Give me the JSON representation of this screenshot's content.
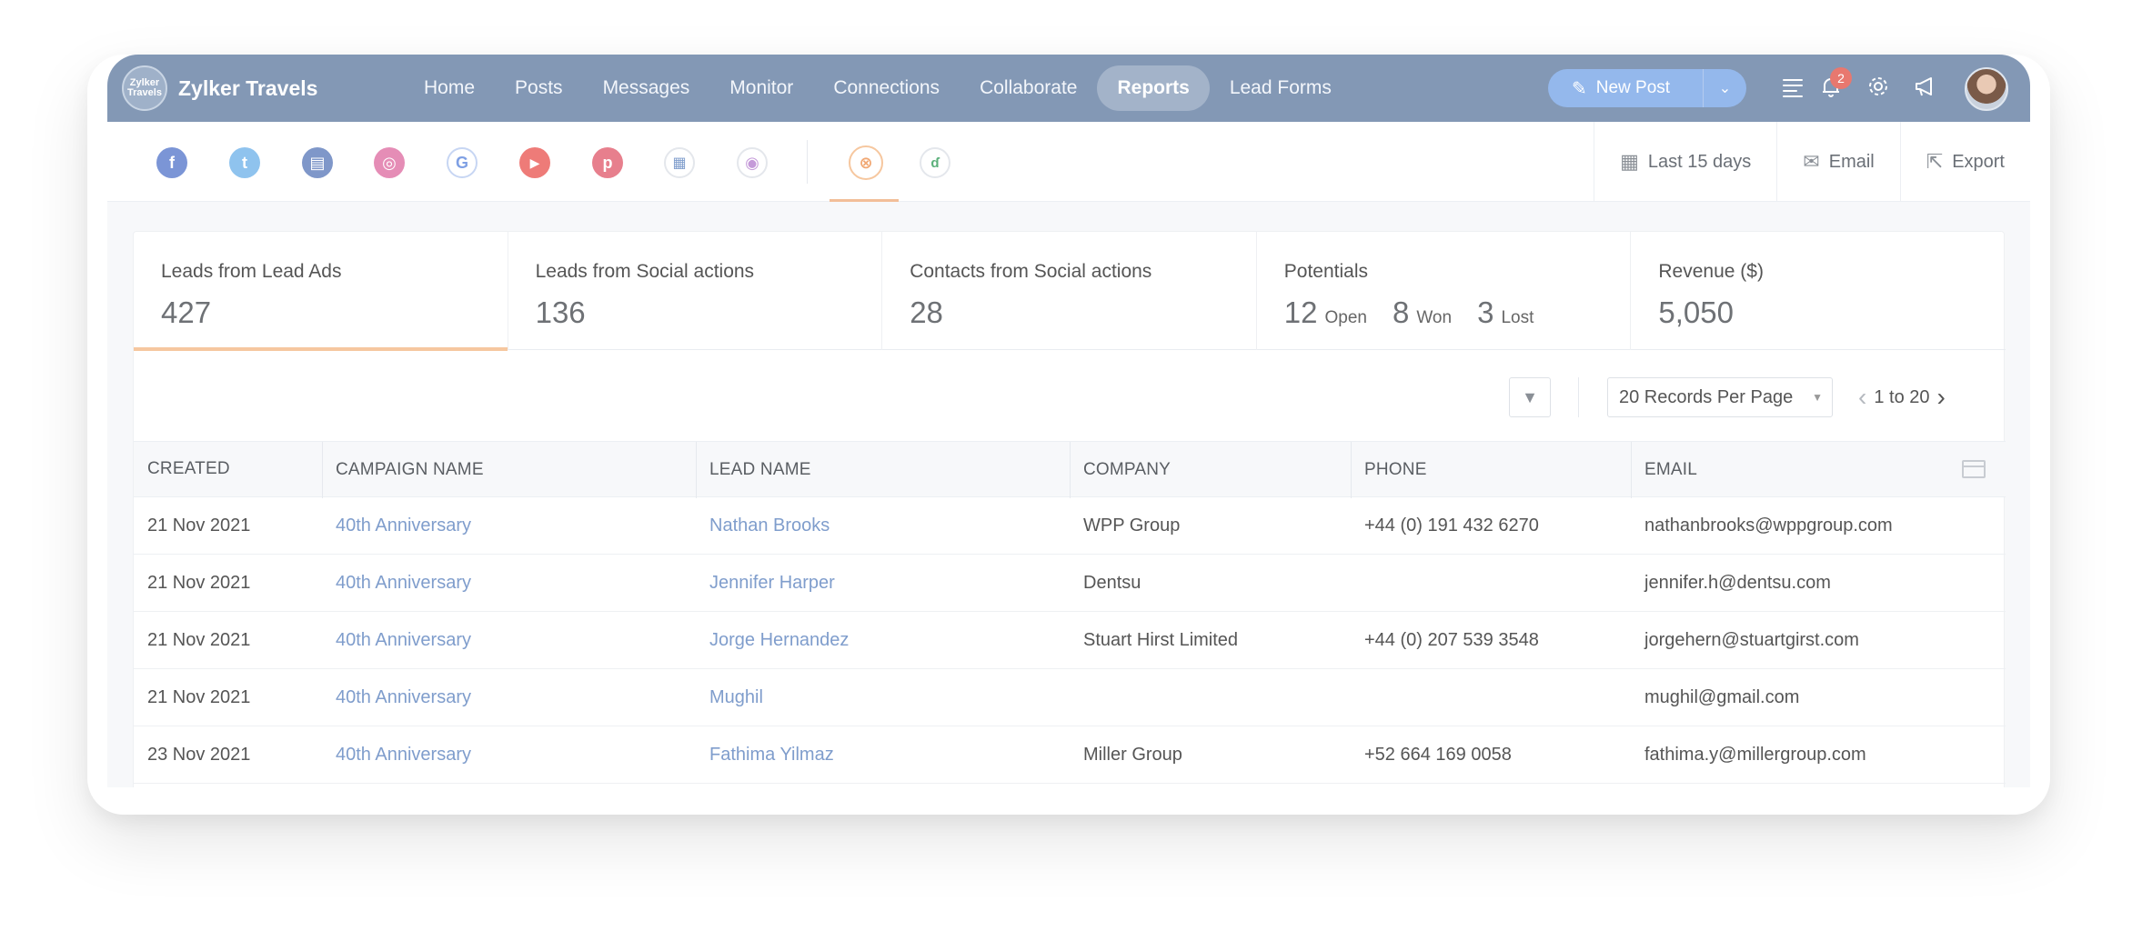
{
  "app": {
    "brand_logo_text": "Zylker Travels",
    "brand_name": "Zylker Travels"
  },
  "nav": {
    "items": [
      {
        "label": "Home"
      },
      {
        "label": "Posts"
      },
      {
        "label": "Messages"
      },
      {
        "label": "Monitor"
      },
      {
        "label": "Connections"
      },
      {
        "label": "Collaborate"
      },
      {
        "label": "Reports",
        "active": true
      },
      {
        "label": "Lead Forms"
      }
    ]
  },
  "header": {
    "new_post_label": "New Post",
    "notification_count": "2",
    "icons": [
      "list-icon",
      "bell-icon",
      "gear-icon",
      "megaphone-icon"
    ]
  },
  "social": {
    "networks": [
      "facebook",
      "twitter",
      "linkedin-page",
      "instagram",
      "google",
      "youtube",
      "pinterest",
      "microsoft",
      "orbit"
    ],
    "extra": [
      "linked-accounts",
      "crm"
    ],
    "active": "linked-accounts"
  },
  "actions": {
    "date_range": "Last 15 days",
    "email": "Email",
    "export": "Export"
  },
  "stats": {
    "lead_ads": {
      "label": "Leads from Lead Ads",
      "value": "427"
    },
    "social_leads": {
      "label": "Leads from Social actions",
      "value": "136"
    },
    "social_contacts": {
      "label": "Contacts from Social actions",
      "value": "28"
    },
    "potentials": {
      "label": "Potentials",
      "open": "12",
      "open_label": "Open",
      "won": "8",
      "won_label": "Won",
      "lost": "3",
      "lost_label": "Lost"
    },
    "revenue": {
      "label": "Revenue ($)",
      "value": "5,050"
    }
  },
  "toolbar": {
    "records_per_page": "20 Records Per Page",
    "page_range": "1 to 20"
  },
  "table": {
    "headers": [
      "CREATED",
      "CAMPAIGN NAME",
      "LEAD NAME",
      "COMPANY",
      "PHONE",
      "EMAIL"
    ],
    "rows": [
      {
        "created": "21 Nov 2021",
        "campaign": "40th Anniversary",
        "lead": "Nathan Brooks",
        "company": "WPP Group",
        "phone": "+44 (0) 191 432 6270",
        "email": "nathanbrooks@wppgroup.com"
      },
      {
        "created": "21 Nov 2021",
        "campaign": "40th Anniversary",
        "lead": "Jennifer Harper",
        "company": "Dentsu",
        "phone": "",
        "email": "jennifer.h@dentsu.com"
      },
      {
        "created": "21 Nov 2021",
        "campaign": "40th Anniversary",
        "lead": "Jorge Hernandez",
        "company": "Stuart Hirst Limited",
        "phone": "+44 (0) 207 539 3548",
        "email": "jorgehern@stuartgirst.com"
      },
      {
        "created": "21 Nov 2021",
        "campaign": "40th Anniversary",
        "lead": "Mughil",
        "company": "",
        "phone": "",
        "email": "mughil@gmail.com"
      },
      {
        "created": "23 Nov 2021",
        "campaign": "40th Anniversary",
        "lead": "Fathima Yilmaz",
        "company": "Miller Group",
        "phone": "+52 664 169 0058",
        "email": "fathima.y@millergroup.com"
      }
    ]
  },
  "colors": {
    "topbar": "#8398b5",
    "accent_orange": "#f6c79f",
    "link": "#7f9dcc",
    "new_post": "#94b8ec"
  }
}
